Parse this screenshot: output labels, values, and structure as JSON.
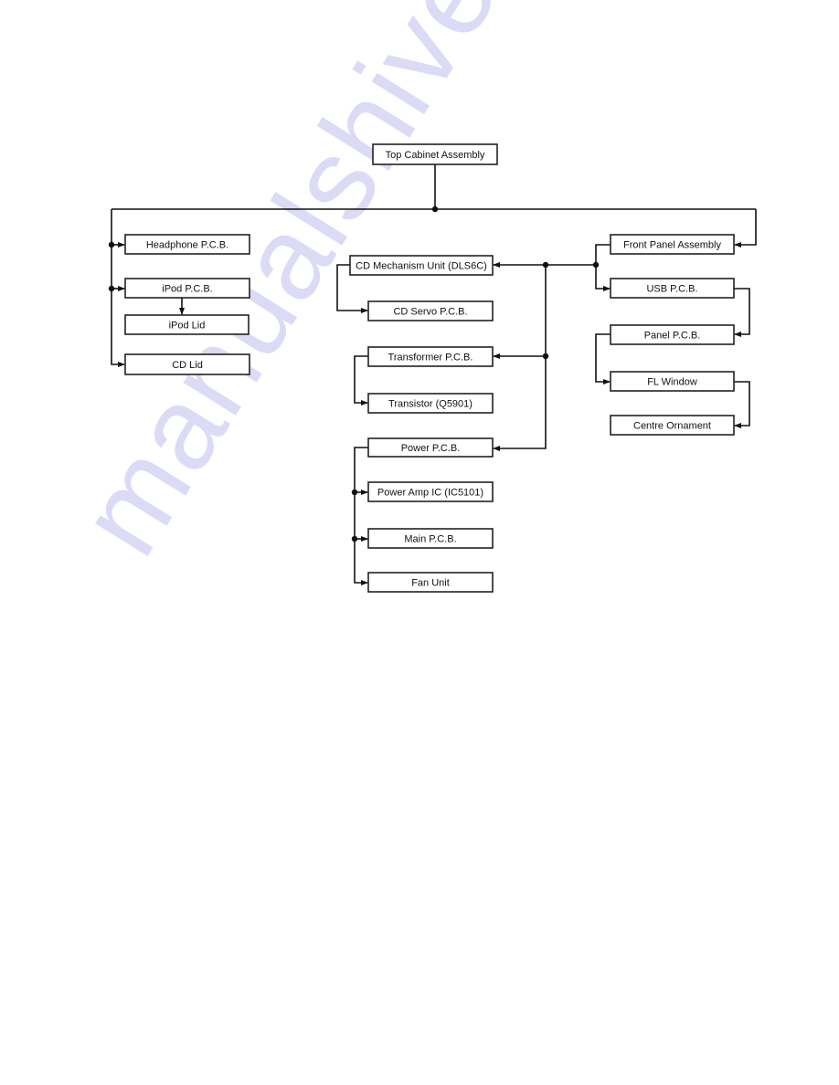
{
  "diagram": {
    "type": "disassembly-flow",
    "root": {
      "id": "top_cabinet",
      "label": "Top Cabinet Assembly"
    },
    "nodes": [
      {
        "id": "top_cabinet",
        "label": "Top Cabinet Assembly"
      },
      {
        "id": "headphone_pcb",
        "label": "Headphone P.C.B."
      },
      {
        "id": "ipod_pcb",
        "label": "iPod P.C.B."
      },
      {
        "id": "ipod_lid",
        "label": "iPod Lid"
      },
      {
        "id": "cd_lid",
        "label": "CD Lid"
      },
      {
        "id": "cd_mech",
        "label": "CD Mechanism Unit (DLS6C)"
      },
      {
        "id": "cd_servo",
        "label": "CD Servo P.C.B."
      },
      {
        "id": "transformer_pcb",
        "label": "Transformer P.C.B."
      },
      {
        "id": "transistor",
        "label": "Transistor (Q5901)"
      },
      {
        "id": "power_pcb",
        "label": "Power P.C.B."
      },
      {
        "id": "power_amp_ic",
        "label": "Power Amp IC (IC5101)"
      },
      {
        "id": "main_pcb",
        "label": "Main P.C.B."
      },
      {
        "id": "fan_unit",
        "label": "Fan Unit"
      },
      {
        "id": "front_panel",
        "label": "Front Panel Assembly"
      },
      {
        "id": "usb_pcb",
        "label": "USB P.C.B."
      },
      {
        "id": "panel_pcb",
        "label": "Panel P.C.B."
      },
      {
        "id": "fl_window",
        "label": "FL Window"
      },
      {
        "id": "centre_ornament",
        "label": "Centre Ornament"
      }
    ],
    "edges": [
      {
        "from": "top_cabinet",
        "to": "headphone_pcb"
      },
      {
        "from": "top_cabinet",
        "to": "ipod_pcb"
      },
      {
        "from": "top_cabinet",
        "to": "cd_lid"
      },
      {
        "from": "top_cabinet",
        "to": "front_panel"
      },
      {
        "from": "ipod_pcb",
        "to": "ipod_lid"
      },
      {
        "from": "front_panel",
        "to": "usb_pcb"
      },
      {
        "from": "front_panel",
        "to": "cd_mech"
      },
      {
        "from": "front_panel",
        "to": "transformer_pcb"
      },
      {
        "from": "front_panel",
        "to": "power_pcb"
      },
      {
        "from": "cd_mech",
        "to": "cd_servo"
      },
      {
        "from": "transformer_pcb",
        "to": "transistor"
      },
      {
        "from": "power_pcb",
        "to": "power_amp_ic"
      },
      {
        "from": "power_pcb",
        "to": "main_pcb"
      },
      {
        "from": "power_pcb",
        "to": "fan_unit"
      },
      {
        "from": "usb_pcb",
        "to": "panel_pcb"
      },
      {
        "from": "panel_pcb",
        "to": "fl_window"
      },
      {
        "from": "fl_window",
        "to": "centre_ornament"
      }
    ]
  },
  "watermark": {
    "text": "manualshive.com",
    "color": "#d8d8f6"
  },
  "colors": {
    "line": "#111111",
    "box_border": "#222222",
    "background": "#ffffff"
  }
}
